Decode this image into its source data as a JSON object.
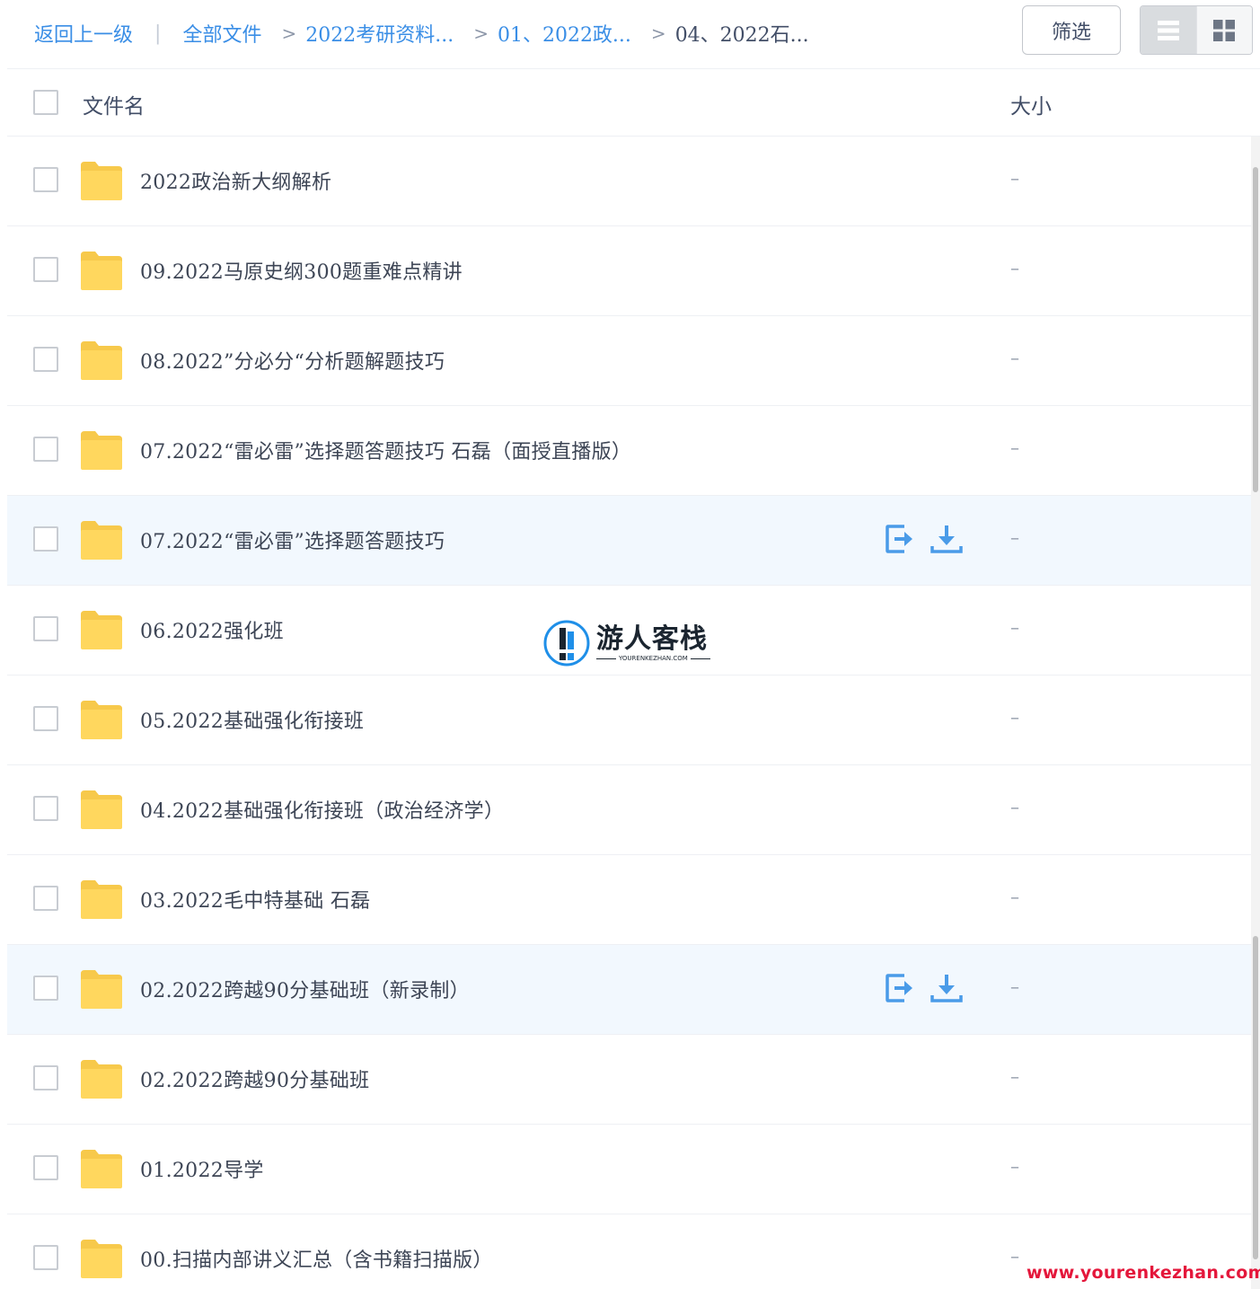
{
  "breadcrumb": {
    "back": "返回上一级",
    "separator_bar": "|",
    "separator": ">",
    "all_files": "全部文件",
    "level1": "2022考研资料...",
    "level2": "01、2022政...",
    "current": "04、2022石..."
  },
  "toolbar": {
    "filter_label": "筛选",
    "view_list_icon": "list-view-icon",
    "view_grid_icon": "grid-view-icon",
    "active_view": "list"
  },
  "table": {
    "col_name": "文件名",
    "col_size": "大小"
  },
  "files": [
    {
      "name": "2022政治新大纲解析",
      "size": "–",
      "hovered": false
    },
    {
      "name": "09.2022马原史纲300题重难点精讲",
      "size": "–",
      "hovered": false
    },
    {
      "name": "08.2022”分必分“分析题解题技巧",
      "size": "–",
      "hovered": false
    },
    {
      "name": "07.2022“雷必雷”选择题答题技巧 石磊（面授直播版）",
      "size": "–",
      "hovered": false
    },
    {
      "name": "07.2022“雷必雷”选择题答题技巧",
      "size": "–",
      "hovered": true
    },
    {
      "name": "06.2022强化班",
      "size": "–",
      "hovered": false
    },
    {
      "name": "05.2022基础强化衔接班",
      "size": "–",
      "hovered": false
    },
    {
      "name": "04.2022基础强化衔接班（政治经济学）",
      "size": "–",
      "hovered": false
    },
    {
      "name": "03.2022毛中特基础 石磊",
      "size": "–",
      "hovered": false
    },
    {
      "name": "02.2022跨越90分基础班（新录制）",
      "size": "–",
      "hovered": true
    },
    {
      "name": "02.2022跨越90分基础班",
      "size": "–",
      "hovered": false
    },
    {
      "name": "01.2022导学",
      "size": "–",
      "hovered": false
    },
    {
      "name": "00.扫描内部讲义汇总（含书籍扫描版）",
      "size": "–",
      "hovered": false
    }
  ],
  "row_actions": {
    "move_icon": "move-to-icon",
    "download_icon": "download-icon"
  },
  "watermark": {
    "title": "游人客栈",
    "subtitle": "YOURENKEZHAN.COM",
    "url": "www.yourenkezhan.com"
  },
  "colors": {
    "link": "#3a8ee6",
    "hover_row": "#f2f8fe",
    "folder": "#ffd75e",
    "action_icon": "#4a9be8",
    "watermark_url": "#e4173b"
  }
}
